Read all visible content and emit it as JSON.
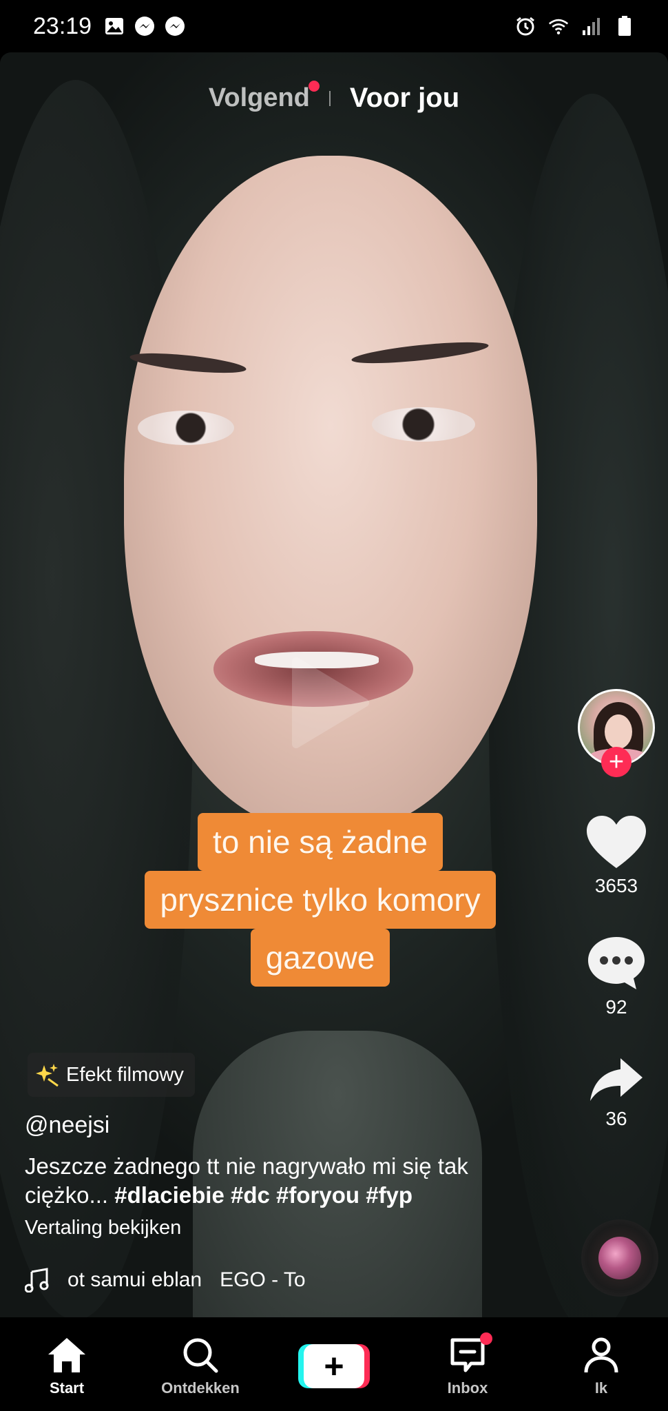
{
  "status_bar": {
    "time": "23:19",
    "left_icons": [
      "image-icon",
      "messenger-icon",
      "messenger-icon"
    ],
    "right_icons": [
      "alarm-icon",
      "wifi-icon",
      "signal-icon",
      "battery-icon"
    ]
  },
  "top_tabs": {
    "following": "Volgend",
    "for_you": "Voor jou"
  },
  "video": {
    "caption_lines": [
      "to nie są żadne",
      "prysznice tylko komory",
      "gazowe"
    ],
    "caption_color": "#ef8a36"
  },
  "actions": {
    "likes": "3653",
    "comments": "92",
    "shares": "36"
  },
  "post": {
    "effect": "Efekt filmowy",
    "username": "@neejsi",
    "description_text": "Jeszcze żadnego tt nie nagrywało  mi się tak ciężko... ",
    "hashtags": [
      "#dlaciebie",
      "#dc",
      "#foryou",
      "#fyp"
    ],
    "translate_label": "Vertaling bekijken",
    "music_artist": "ot samui eblan",
    "music_title": "EGO - To"
  },
  "bottom_nav": {
    "items": [
      {
        "label": "Start",
        "icon": "home-icon",
        "active": true
      },
      {
        "label": "Ontdekken",
        "icon": "search-icon",
        "active": false
      },
      {
        "label": "",
        "icon": "create-plus-icon",
        "active": false
      },
      {
        "label": "Inbox",
        "icon": "inbox-icon",
        "active": false,
        "badge": true
      },
      {
        "label": "Ik",
        "icon": "profile-icon",
        "active": false
      }
    ]
  },
  "colors": {
    "accent": "#fe2c55",
    "cyan": "#25f4ee"
  }
}
